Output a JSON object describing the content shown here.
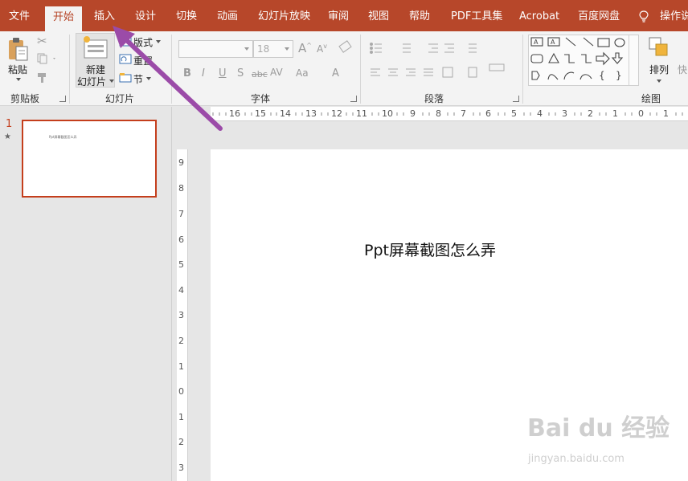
{
  "tabs": [
    {
      "label": "文件",
      "active": false
    },
    {
      "label": "开始",
      "active": true
    },
    {
      "label": "插入",
      "active": false
    },
    {
      "label": "设计",
      "active": false
    },
    {
      "label": "切换",
      "active": false
    },
    {
      "label": "动画",
      "active": false
    },
    {
      "label": "幻灯片放映",
      "active": false
    },
    {
      "label": "审阅",
      "active": false
    },
    {
      "label": "视图",
      "active": false
    },
    {
      "label": "帮助",
      "active": false
    },
    {
      "label": "PDF工具集",
      "active": false
    },
    {
      "label": "Acrobat",
      "active": false
    },
    {
      "label": "百度网盘",
      "active": false
    }
  ],
  "tell_me": "操作说",
  "ribbon": {
    "clipboard": {
      "paste": "粘贴",
      "label": "剪贴板"
    },
    "slides": {
      "new_slide_1": "新建",
      "new_slide_2": "幻灯片",
      "layout": "版式",
      "reset": "重置",
      "section": "节",
      "label": "幻灯片"
    },
    "font": {
      "name_value": "",
      "size_value": "18",
      "label": "字体"
    },
    "paragraph": {
      "label": "段落"
    },
    "drawing": {
      "arrange": "排列",
      "quick_styles": "快",
      "label": "绘图"
    }
  },
  "ruler": {
    "horizontal": [
      "16",
      "15",
      "14",
      "13",
      "12",
      "11",
      "10",
      "9",
      "8",
      "7",
      "6",
      "5",
      "4",
      "3",
      "2",
      "1",
      "0",
      "1"
    ],
    "vertical": [
      "9",
      "8",
      "7",
      "6",
      "5",
      "4",
      "3",
      "2",
      "1",
      "0",
      "1",
      "2",
      "3"
    ]
  },
  "slides_panel": {
    "number": "1",
    "star": "★",
    "thumb_text": "Ppt屏幕截图怎么弄"
  },
  "slide": {
    "title": "Ppt屏幕截图怎么弄"
  },
  "watermark": {
    "logo": "Bai du 经验",
    "url": "jingyan.baidu.com"
  },
  "colors": {
    "accent": "#b7472a",
    "arrow": "#9b4ba8"
  }
}
